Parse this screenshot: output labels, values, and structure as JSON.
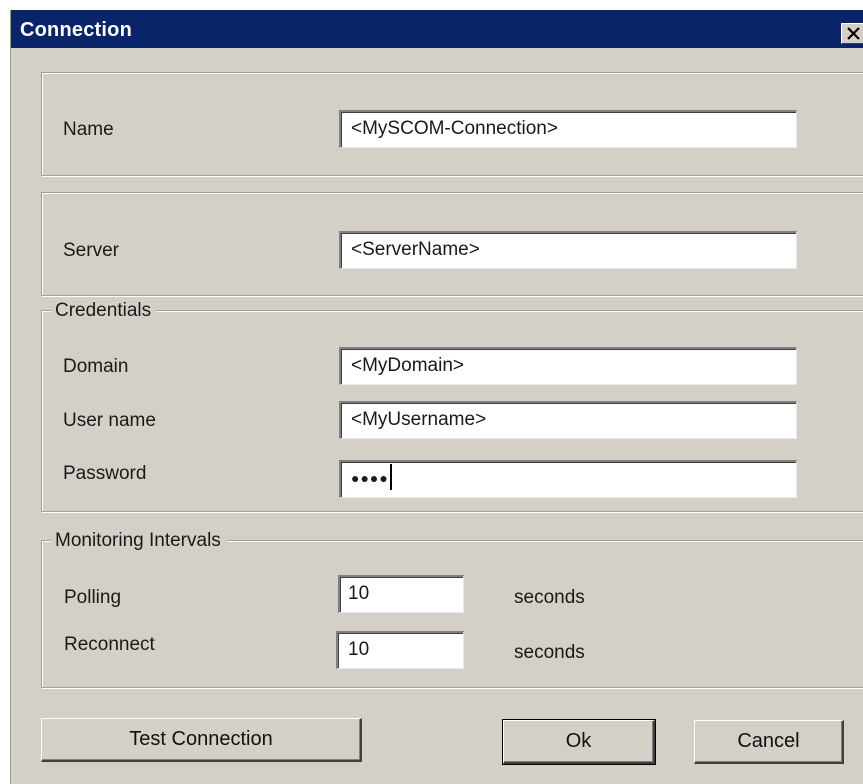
{
  "window": {
    "title": "Connection",
    "close_icon": "close-icon"
  },
  "name_section": {
    "label": "Name",
    "value": "<MySCOM-Connection>"
  },
  "server_section": {
    "label": "Server",
    "value": "<ServerName>"
  },
  "credentials": {
    "legend": "Credentials",
    "domain_label": "Domain",
    "domain_value": "<MyDomain>",
    "username_label": "User name",
    "username_value": "<MyUsername>",
    "password_label": "Password",
    "password_mask": "●●●●"
  },
  "monitoring": {
    "legend": "Monitoring Intervals",
    "polling_label": "Polling",
    "polling_value": "10",
    "polling_unit": "seconds",
    "reconnect_label": "Reconnect",
    "reconnect_value": "10",
    "reconnect_unit": "seconds"
  },
  "buttons": {
    "test_connection": "Test Connection",
    "ok": "Ok",
    "cancel": "Cancel"
  },
  "colors": {
    "titlebar": "#0a246a",
    "dialog_background": "#d4d0c8"
  }
}
